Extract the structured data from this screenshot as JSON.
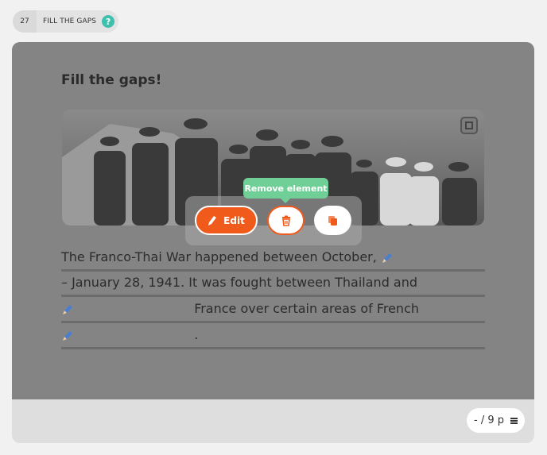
{
  "header": {
    "number": "27",
    "title": "FILL THE GAPS",
    "help_label": "?"
  },
  "card": {
    "title": "Fill the gaps!",
    "lines": [
      {
        "text": "The Franco-Thai War happened between October,"
      },
      {
        "text": "– January 28, 1941. It was fought between Thailand and"
      },
      {
        "text": "France over certain areas of French"
      },
      {
        "text": "."
      }
    ]
  },
  "toolbar": {
    "edit_label": "Edit",
    "tooltip": "Remove element",
    "icons": {
      "edit": "pencil-icon",
      "delete": "trash-icon",
      "copy": "copy-icon"
    }
  },
  "footer": {
    "pager": "- / 9 p"
  },
  "colors": {
    "accent": "#f05a1a",
    "tooltip": "#6fcf97",
    "help": "#3fbfae",
    "gap_pen": "#4a7fd0"
  }
}
